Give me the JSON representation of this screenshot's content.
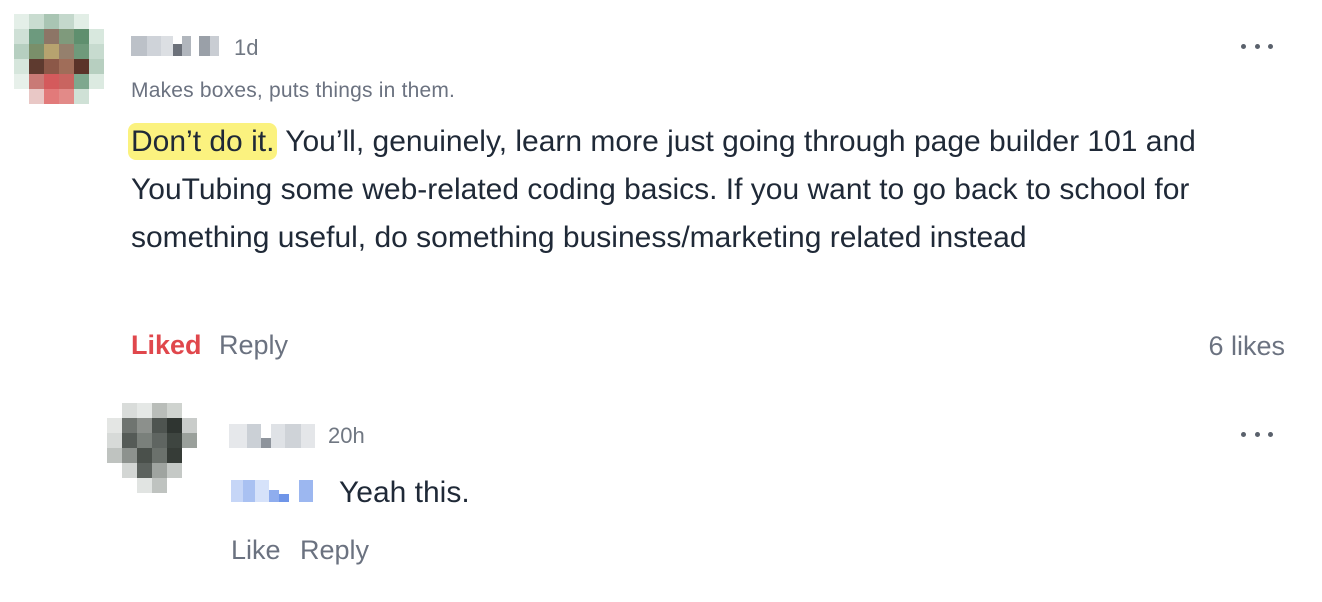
{
  "comment": {
    "timestamp": "1d",
    "author_bio": "Makes boxes, puts things in them.",
    "highlight_text": "Don’t do it.",
    "body_text": " You’ll, genuinely, learn more just going through page builder 101 and YouTubing some web-related coding basics. If you want to go back to school for something useful, do something business/marketing related instead",
    "like_label": "Liked",
    "reply_label": "Reply",
    "likes_count": "6 likes",
    "liked": true
  },
  "reply": {
    "timestamp": "20h",
    "body_text": "Yeah this.",
    "like_label": "Like",
    "reply_label": "Reply",
    "liked": false
  },
  "colors": {
    "liked": "#e0474c",
    "highlight": "#fbf27f",
    "muted_text": "#6b7280",
    "body_text": "#1f2937"
  }
}
